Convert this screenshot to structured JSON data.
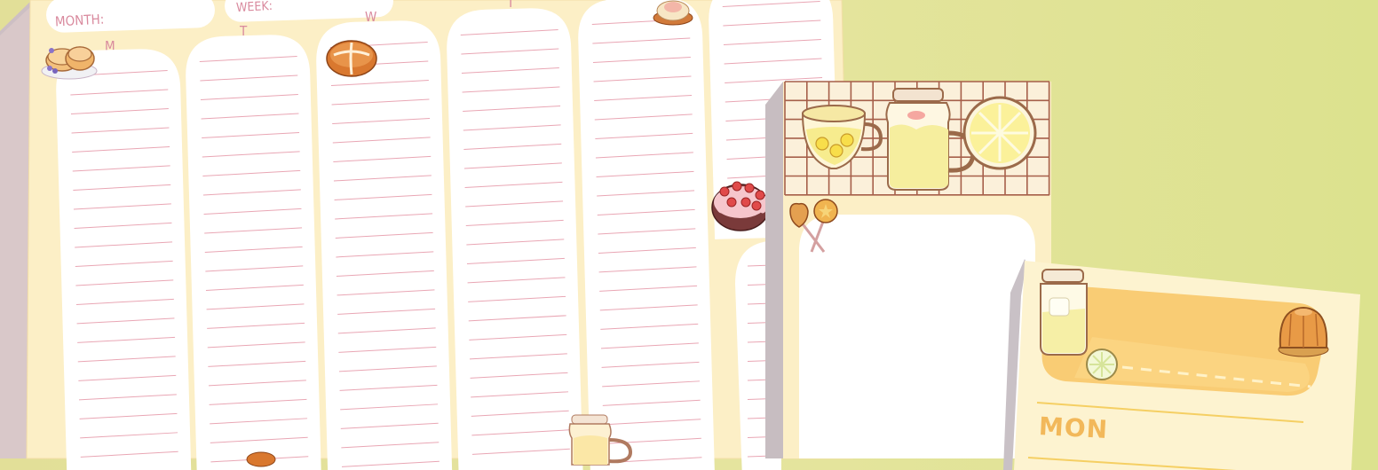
{
  "planner": {
    "month_label": "MONTH:",
    "week_label": "WEEK:",
    "days": [
      "M",
      "T",
      "W",
      "T"
    ]
  },
  "daily_card": {
    "day_label": "MON"
  },
  "colors": {
    "background": "#e3e19a",
    "paper": "#fcefc6",
    "line": "#e8a2b2",
    "accent": "#f6c56b",
    "mon_text": "#f2b85a"
  },
  "illustrations": [
    "pancakes",
    "bread-bun",
    "cupcake",
    "strawberry-cake",
    "tea-cup",
    "lemonade-jar",
    "lemon-slice",
    "lollipops",
    "jar",
    "pudding"
  ]
}
